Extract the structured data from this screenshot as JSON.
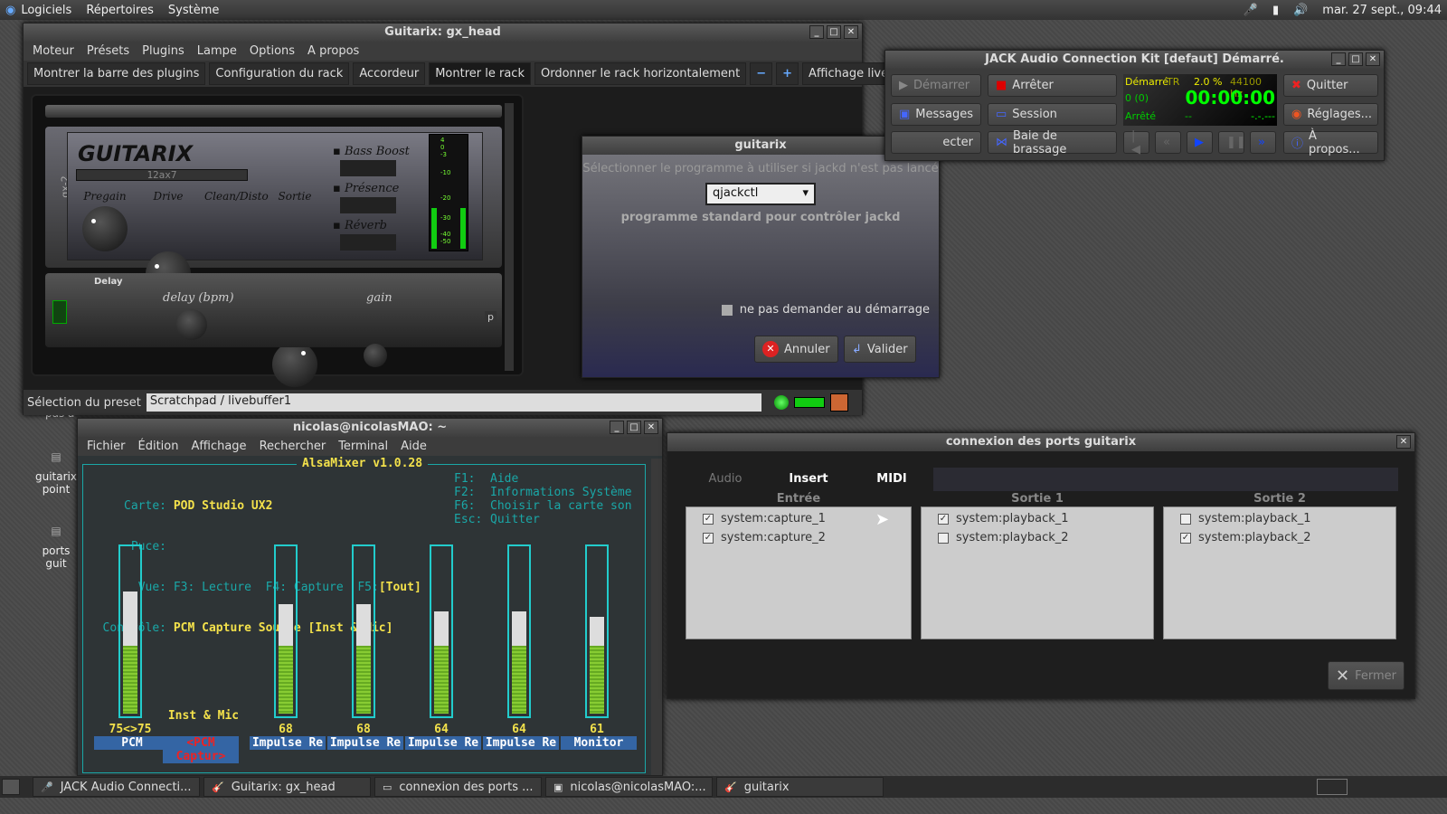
{
  "panel": {
    "menus": [
      "Logiciels",
      "Répertoires",
      "Système"
    ],
    "clock": "mar. 27 sept., 09:44"
  },
  "desktop": {
    "icons": [
      "guitarix point",
      "ports guit"
    ],
    "partial": "pas a"
  },
  "guitarix": {
    "title": "Guitarix: gx_head",
    "menu": [
      "Moteur",
      "Présets",
      "Plugins",
      "Lampe",
      "Options",
      "A propos"
    ],
    "toolbar": [
      "Montrer la barre des plugins",
      "Configuration du rack",
      "Accordeur",
      "Montrer le rack",
      "Ordonner le rack horizontalement",
      "−",
      "+",
      "Affichage live"
    ],
    "amp": {
      "logo": "GUITARIX",
      "side": "gx-2",
      "tube": "12ax7",
      "knobs": [
        "Pregain",
        "Drive",
        "Clean/Disto",
        "Sortie"
      ],
      "switches": [
        "Bass Boost",
        "Présence",
        "Réverb"
      ],
      "meter_ticks": [
        "4",
        "0",
        "-3",
        "-10",
        "-20",
        "-30",
        "-40",
        "-50"
      ]
    },
    "delay": {
      "title": "Delay",
      "knobs": [
        "delay (bpm)",
        "gain"
      ],
      "side": "p"
    },
    "preset_label": "Sélection du preset",
    "preset_value": "Scratchpad / livebuffer1"
  },
  "dialog": {
    "title": "guitarix",
    "prompt": "Sélectionner le programme à utiliser si jackd n'est pas lancé",
    "select": "qjackctl",
    "description": "programme standard pour contrôler jackd",
    "checkbox": "ne pas demander au démarrage",
    "cancel": "Annuler",
    "ok": "Valider"
  },
  "jack": {
    "title": "JACK Audio Connection Kit [defaut] Démarré.",
    "buttons": {
      "start": "Démarrer",
      "stop": "Arrêter",
      "quit": "Quitter",
      "messages": "Messages",
      "session": "Session",
      "settings": "Réglages...",
      "connect": "ecter",
      "patchbay": "Baie de brassage",
      "about": "À propos..."
    },
    "display": {
      "status": "Démarré",
      "tr": "TR",
      "dsp": "2.0 %",
      "rate": "44100 Hz",
      "xruns": "0 (0)",
      "time": "00:00:00",
      "transport": "Arrêté",
      "bpm": "--",
      "frame": "-.-.---"
    }
  },
  "terminal": {
    "title": "nicolas@nicolasMAO: ~",
    "menu": [
      "Fichier",
      "Édition",
      "Affichage",
      "Rechercher",
      "Terminal",
      "Aide"
    ],
    "alsamixer": {
      "header": "AlsaMixer v1.0.28",
      "card_label": "Carte:",
      "card": "POD Studio UX2",
      "chip_label": "Puce:",
      "view_label": "Vue:",
      "view_f3": "F3: Lecture",
      "view_f4": "F4: Capture",
      "view_f5": "F5:",
      "view_sel": "[Tout]",
      "control_label": "Contrôle:",
      "control": "PCM Capture Source [Inst & Mic]",
      "keys": [
        [
          "F1:",
          "Aide"
        ],
        [
          "F2:",
          "Informations Système"
        ],
        [
          "F6:",
          "Choisir la carte son"
        ],
        [
          "Esc:",
          "Quitter"
        ]
      ],
      "enum_value": "Inst & Mic",
      "channels": [
        {
          "name": "PCM",
          "value": "75<>75",
          "level": 75
        },
        {
          "name": "<PCM Captur>",
          "value": "",
          "level": null
        },
        {
          "name": "Impulse Re",
          "value": "68",
          "level": 68
        },
        {
          "name": "Impulse Re",
          "value": "68",
          "level": 68
        },
        {
          "name": "Impulse Re",
          "value": "64",
          "level": 64
        },
        {
          "name": "Impulse Re",
          "value": "64",
          "level": 64
        },
        {
          "name": "Monitor",
          "value": "61",
          "level": 61
        }
      ]
    }
  },
  "ports": {
    "title": "connexion des ports guitarix",
    "tabs": [
      "Audio",
      "Insert",
      "MIDI"
    ],
    "columns": [
      {
        "header": "Entrée",
        "items": [
          {
            "label": "system:capture_1",
            "checked": true
          },
          {
            "label": "system:capture_2",
            "checked": true
          }
        ]
      },
      {
        "header": "Sortie 1",
        "items": [
          {
            "label": "system:playback_1",
            "checked": true
          },
          {
            "label": "system:playback_2",
            "checked": false
          }
        ]
      },
      {
        "header": "Sortie 2",
        "items": [
          {
            "label": "system:playback_1",
            "checked": false
          },
          {
            "label": "system:playback_2",
            "checked": true
          }
        ]
      }
    ],
    "close": "Fermer"
  },
  "taskbar": [
    "JACK Audio Connecti...",
    "Guitarix: gx_head",
    "connexion des ports ...",
    "nicolas@nicolasMAO:...",
    "guitarix"
  ]
}
